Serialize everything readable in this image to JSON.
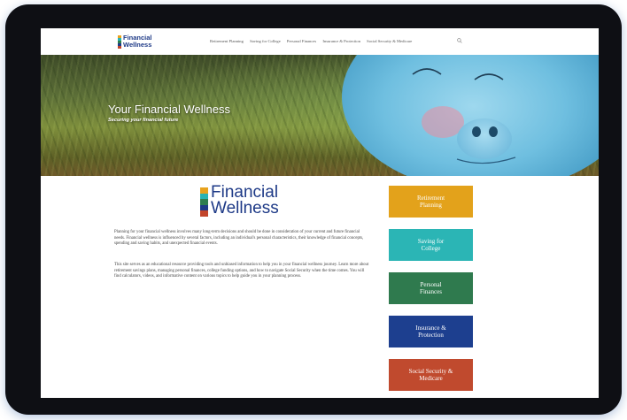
{
  "logo": {
    "line1": "Financial",
    "line2": "Wellness",
    "bar_colors": [
      "#e8a21d",
      "#29b3b3",
      "#2e7d4f",
      "#1e3a87",
      "#c2452b"
    ]
  },
  "nav": {
    "items": [
      {
        "label": "Retirement Planning"
      },
      {
        "label": "Saving for College"
      },
      {
        "label": "Personal Finances"
      },
      {
        "label": "Insurance & Protection"
      },
      {
        "label": "Social Security & Medicare"
      }
    ],
    "search_icon": "search-icon"
  },
  "hero": {
    "title": "Your Financial Wellness",
    "subtitle": "Securing your financial future"
  },
  "content": {
    "paragraph1": "Planning for your financial wellness involves many long-term decisions and should be done in consideration of your current and future financial needs. Financial wellness is influenced by several factors, including an individual's personal characteristics, their knowledge of financial concepts, spending and saving habits, and unexpected financial events.",
    "paragraph2": "This site serves as an educational resource providing tools and unbiased information to help you in your financial wellness journey. Learn more about retirement savings plans, managing personal finances, college funding options, and how to navigate Social Security when the time comes. You will find calculators, videos, and informative content on various topics to help guide you in your planning process."
  },
  "tiles": [
    {
      "label": "Retirement\nPlanning",
      "color": "#e3a21b"
    },
    {
      "label": "Saving for\nCollege",
      "color": "#2bb5b5"
    },
    {
      "label": "Personal\nFinances",
      "color": "#2f7a4e"
    },
    {
      "label": "Insurance &\nProtection",
      "color": "#1d3f8f"
    },
    {
      "label": "Social Security &\nMedicare",
      "color": "#c04a2e"
    }
  ]
}
